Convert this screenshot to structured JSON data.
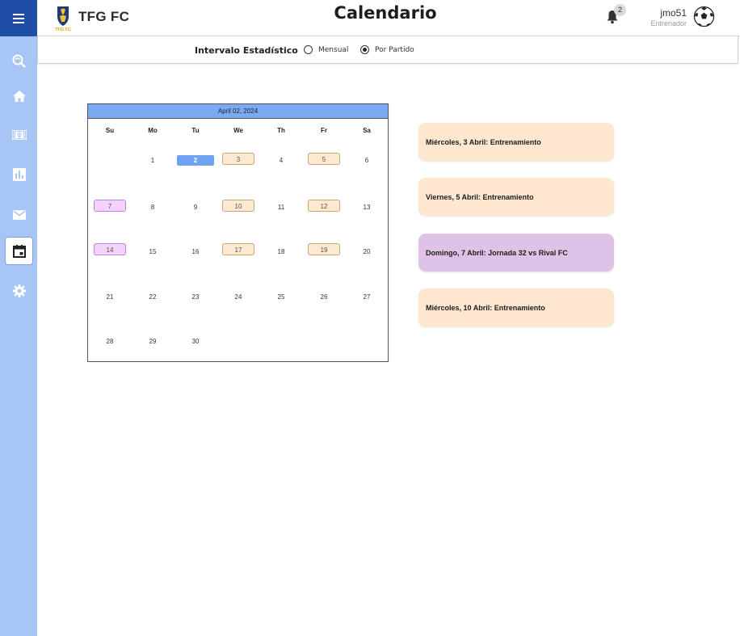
{
  "header": {
    "brand": "TFG FC",
    "logo_caption": "TFG FC",
    "title": "Calendario",
    "notification_count": "2",
    "user_name": "jmo51",
    "user_role": "Entrenador"
  },
  "filter": {
    "label": "Intervalo Estadístico",
    "options": [
      "Mensual",
      "Por Partido"
    ],
    "selected": "Por Partido"
  },
  "sidebar": {
    "items": [
      "search-icon",
      "home-icon",
      "field-icon",
      "bar-chart-icon",
      "mail-icon",
      "calendar-icon",
      "settings-icon"
    ],
    "active": "calendar-icon"
  },
  "calendar": {
    "header": "April 02, 2024",
    "weekdays": [
      "Su",
      "Mo",
      "Tu",
      "We",
      "Th",
      "Fr",
      "Sa"
    ],
    "days": [
      "1",
      "2",
      "3",
      "4",
      "5",
      "6",
      "7",
      "8",
      "9",
      "10",
      "11",
      "12",
      "13",
      "14",
      "15",
      "16",
      "17",
      "18",
      "19",
      "20",
      "21",
      "22",
      "23",
      "24",
      "25",
      "26",
      "27",
      "28",
      "29",
      "30"
    ],
    "today": "2",
    "training_days": [
      "3",
      "5",
      "10",
      "12",
      "17",
      "19"
    ],
    "match_days": [
      "7",
      "14"
    ]
  },
  "events": [
    {
      "text": "Miércoles, 3 Abril: Entrenamiento",
      "type": "training"
    },
    {
      "text": "Viernes, 5 Abril: Entrenamiento",
      "type": "training"
    },
    {
      "text": "Domingo, 7 Abril: Jornada 32 vs Rival FC",
      "type": "match"
    },
    {
      "text": "Miércoles, 10 Abril: Entrenamiento",
      "type": "training"
    }
  ],
  "colors": {
    "sidebar_bg": "#a8c6f5",
    "menu_bg": "#1e4ea8",
    "calendar_header": "#7aaaf5",
    "training": "#fde7cf",
    "match": "#dfc3e6"
  }
}
